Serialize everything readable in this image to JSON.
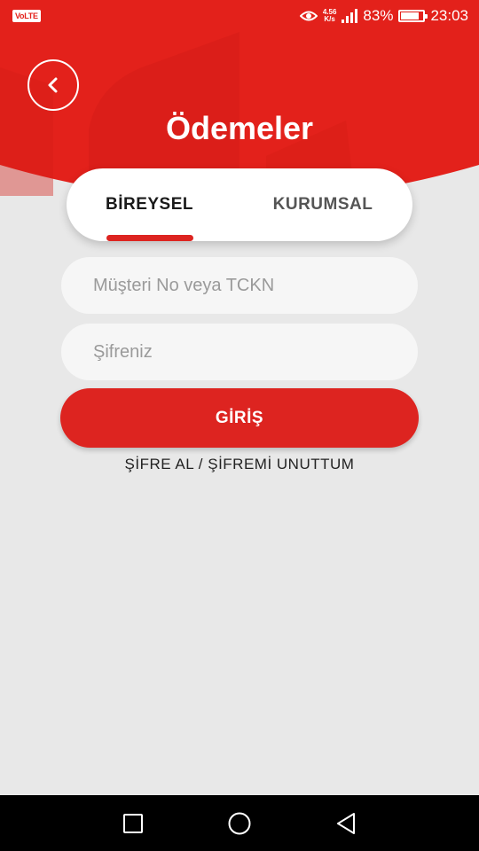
{
  "status_bar": {
    "volte": "VoLTE",
    "net_speed_top": "4.56",
    "net_speed_bottom": "K/s",
    "battery_percent_text": "83%",
    "battery_level": 0.83,
    "time": "23:03",
    "icons": [
      "eye-icon",
      "signal-icon",
      "battery-icon"
    ]
  },
  "header": {
    "title": "Ödemeler",
    "back_icon": "chevron-left-icon",
    "color": "#e3211b"
  },
  "tabs": [
    {
      "label": "BİREYSEL",
      "active": true
    },
    {
      "label": "KURUMSAL",
      "active": false
    }
  ],
  "form": {
    "customer_placeholder": "Müşteri No veya TCKN",
    "customer_value": "",
    "password_placeholder": "Şifreniz",
    "password_value": "",
    "login_label": "GİRİŞ",
    "forgot_label": "ŞİFRE AL / ŞİFREMİ UNUTTUM"
  },
  "nav_bar": {
    "icons": [
      "recent-apps-icon",
      "home-icon",
      "back-icon"
    ]
  },
  "colors": {
    "accent": "#dd2420",
    "background": "#e8e8e8"
  }
}
